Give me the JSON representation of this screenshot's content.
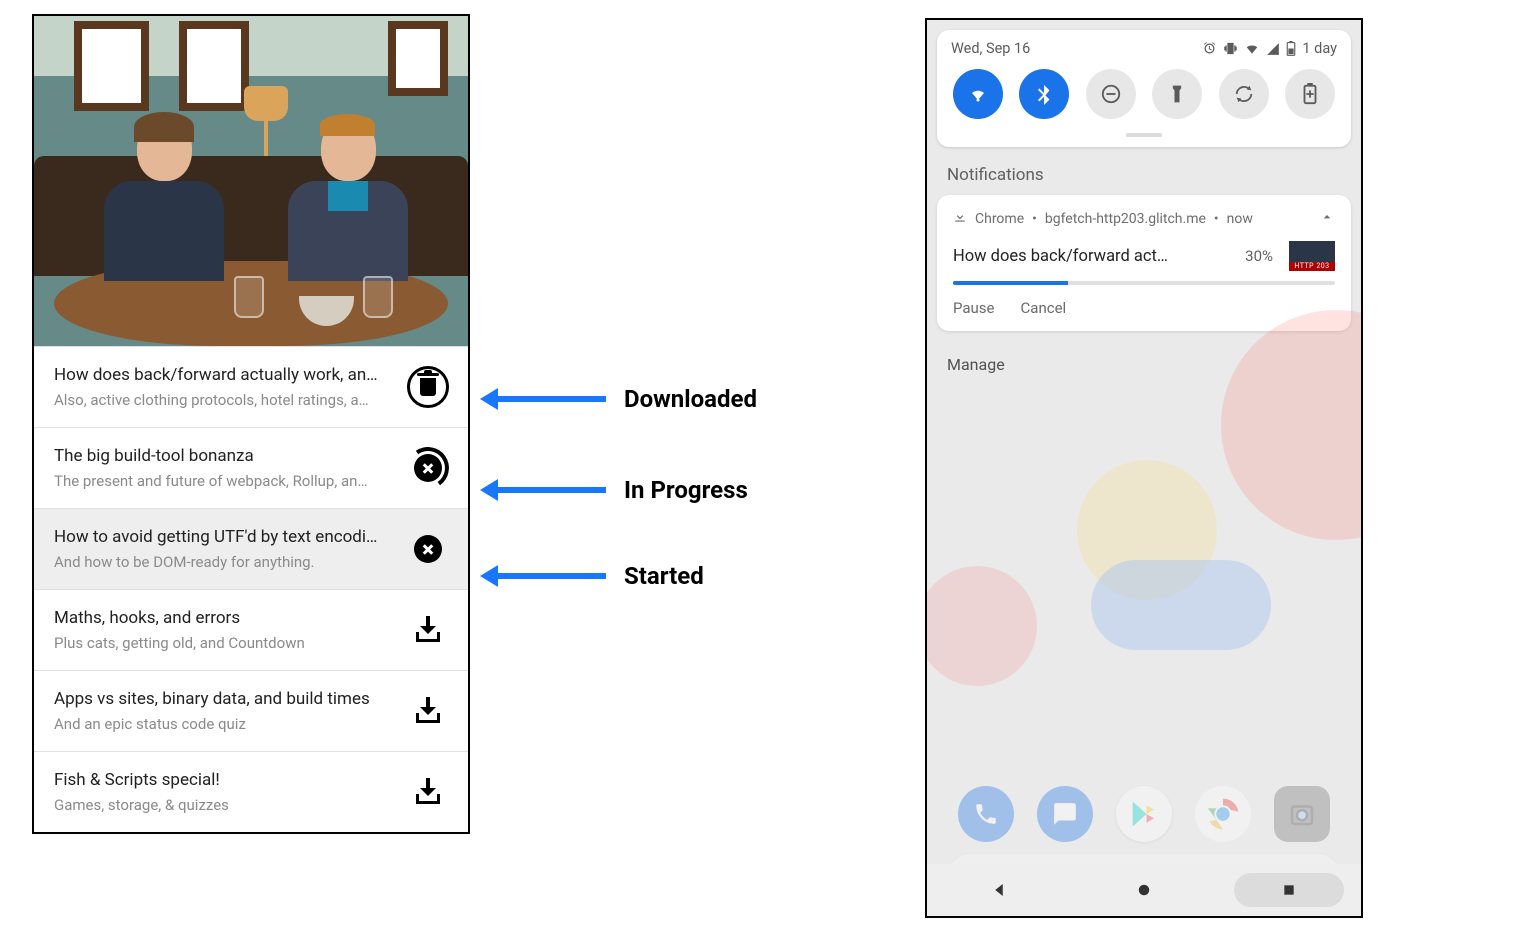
{
  "annotations": {
    "downloaded": "Downloaded",
    "in_progress": "In Progress",
    "started": "Started"
  },
  "list_items": [
    {
      "title": "How does back/forward actually work, an…",
      "subtitle": "Also, active clothing protocols, hotel ratings, a…",
      "icon": "trash",
      "status": "downloaded"
    },
    {
      "title": "The big build-tool bonanza",
      "subtitle": "The present and future of webpack, Rollup, an…",
      "icon": "progress",
      "status": "in-progress"
    },
    {
      "title": "How to avoid getting UTF'd by text encodi…",
      "subtitle": "And how to be DOM-ready for anything.",
      "icon": "cancel",
      "status": "started",
      "selected": true
    },
    {
      "title": "Maths, hooks, and errors",
      "subtitle": "Plus cats, getting old, and Countdown",
      "icon": "download"
    },
    {
      "title": "Apps vs sites, binary data, and build times",
      "subtitle": "And an epic status code quiz",
      "icon": "download"
    },
    {
      "title": "Fish & Scripts special!",
      "subtitle": "Games, storage, & quizzes",
      "icon": "download"
    }
  ],
  "phone": {
    "date": "Wed, Sep 16",
    "battery_text": "1 day",
    "heading": "Notifications",
    "manage": "Manage",
    "notification": {
      "app": "Chrome",
      "source": "bgfetch-http203.glitch.me",
      "time": "now",
      "title": "How does back/forward act…",
      "percent": "30%",
      "progress": 30,
      "thumb_label": "HTTP 203",
      "actions": {
        "pause": "Pause",
        "cancel": "Cancel"
      }
    }
  }
}
